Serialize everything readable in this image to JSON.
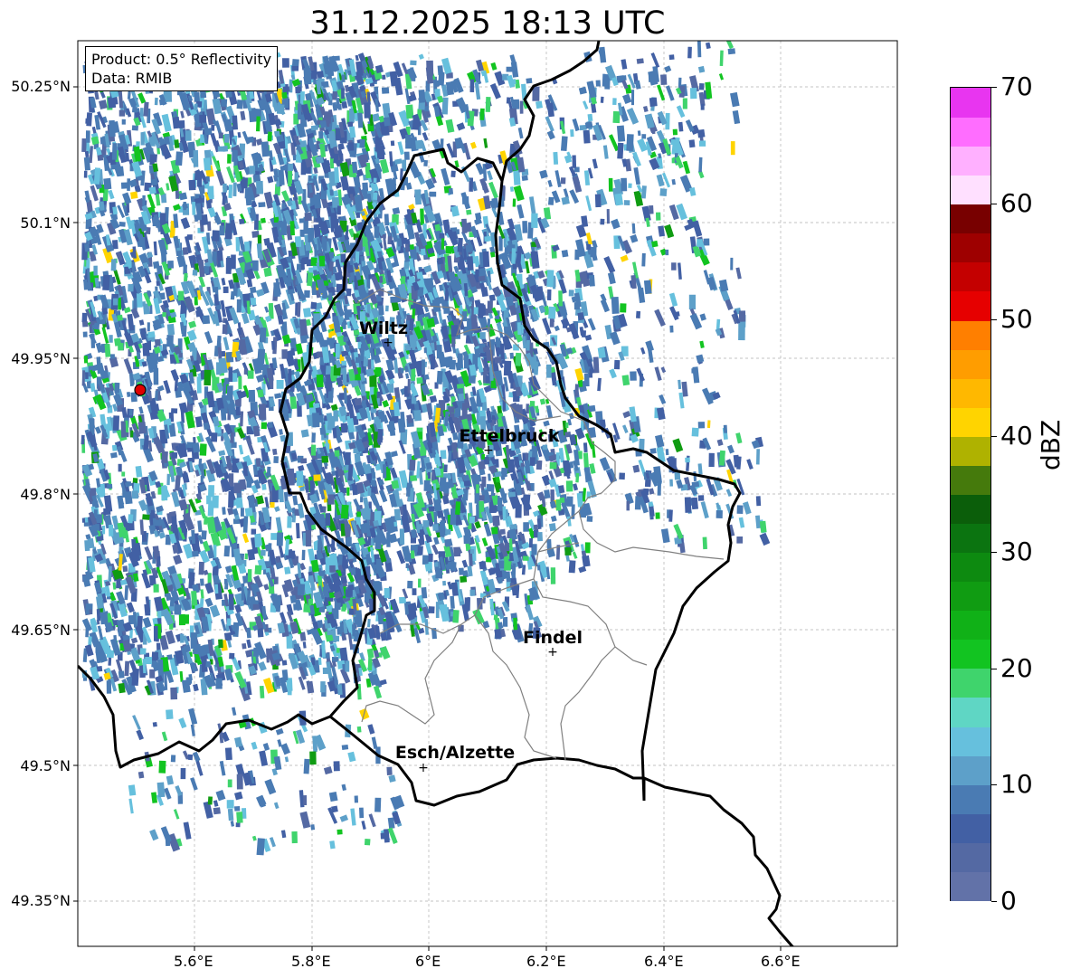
{
  "title": "31.12.2025 18:13 UTC",
  "info_box": {
    "product": "Product: 0.5° Reflectivity",
    "data": "Data: RMIB"
  },
  "axes": {
    "lon_ticks": [
      "5.6°E",
      "5.8°E",
      "6°E",
      "6.2°E",
      "6.4°E",
      "6.6°E"
    ],
    "lat_ticks": [
      "50.25°N",
      "50.1°N",
      "49.95°N",
      "49.8°N",
      "49.65°N",
      "49.5°N",
      "49.35°N"
    ],
    "grid": true
  },
  "cities": [
    {
      "name": "Wiltz",
      "lon": 5.93,
      "lat": 49.97
    },
    {
      "name": "Ettelbruck",
      "lon": 6.1,
      "lat": 49.85
    },
    {
      "name": "Findel",
      "lon": 6.21,
      "lat": 49.63
    },
    {
      "name": "Esch/Alzette",
      "lon": 5.99,
      "lat": 49.5
    }
  ],
  "radar_site": {
    "lon": 5.51,
    "lat": 49.92,
    "color": "#e00000"
  },
  "colorbar": {
    "label": "dBZ",
    "tick_labels": [
      "0",
      "10",
      "20",
      "30",
      "40",
      "50",
      "60",
      "70"
    ],
    "min": 0,
    "max": 70,
    "step": 2.5,
    "colors": [
      "#6272a8",
      "#5469a3",
      "#4260a4",
      "#4a7bb3",
      "#5da0c9",
      "#66c0dd",
      "#5fd6c4",
      "#3fd46c",
      "#12c421",
      "#10b117",
      "#109c12",
      "#0d8a10",
      "#0b7410",
      "#0b5e0a",
      "#457a0c",
      "#afb200",
      "#ffd400",
      "#ffb800",
      "#ff9d00",
      "#ff7f00",
      "#e60000",
      "#c40000",
      "#9e0000",
      "#780000",
      "#ffe0ff",
      "#ffb0ff",
      "#ff6dff",
      "#e835f0"
    ]
  }
}
